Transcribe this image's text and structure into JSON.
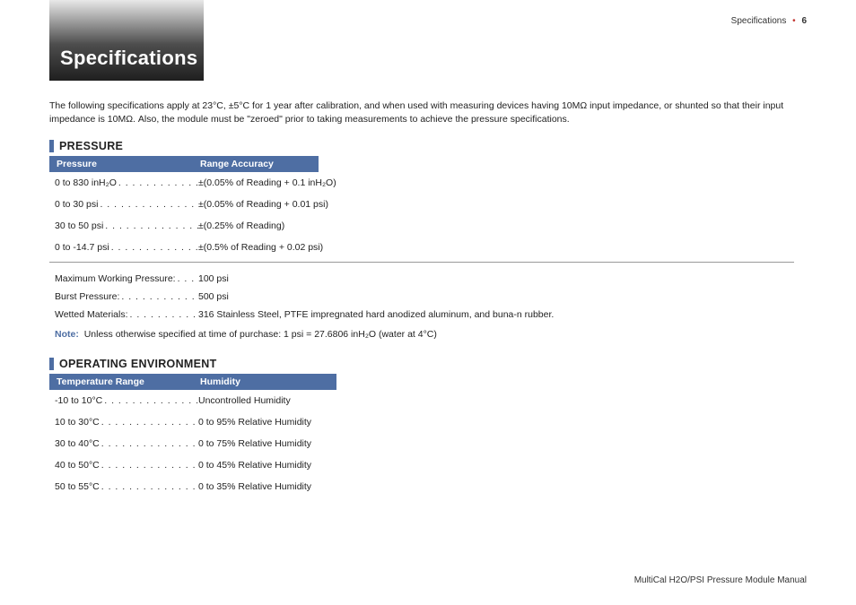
{
  "header": {
    "section": "Specifications",
    "page": "6"
  },
  "title": "Specifications",
  "intro": "The following specifications apply at 23°C, ±5°C for 1 year after calibration, and when used with measuring devices having 10MΩ input impedance, or shunted so that their input impedance is 10MΩ. Also, the module must be \"zeroed\" prior to taking measurements to achieve the pressure specifications.",
  "pressure": {
    "heading": "PRESSURE",
    "col1": "Pressure",
    "col2": "Range Accuracy",
    "rows": [
      {
        "range": "0 to 830 inH₂O",
        "accuracy": "±(0.05% of Reading + 0.1 inH₂O)"
      },
      {
        "range": "0 to 30 psi",
        "accuracy": "±(0.05% of Reading + 0.01 psi)"
      },
      {
        "range": "30 to 50 psi",
        "accuracy": "±(0.25% of Reading)"
      },
      {
        "range": "0 to -14.7 psi",
        "accuracy": "±(0.5% of Reading + 0.02 psi)"
      }
    ],
    "extras": [
      {
        "k": "Maximum Working Pressure:",
        "v": "100 psi"
      },
      {
        "k": "Burst Pressure:",
        "v": "500 psi"
      },
      {
        "k": "Wetted Materials:",
        "v": "316 Stainless Steel, PTFE impregnated hard anodized aluminum, and buna-n rubber."
      }
    ],
    "note_label": "Note:",
    "note_text": "Unless otherwise specified at time of purchase: 1 psi = 27.6806 inH₂O (water at 4°C)"
  },
  "env": {
    "heading": "OPERATING ENVIRONMENT",
    "col1": "Temperature Range",
    "col2": "Humidity",
    "rows": [
      {
        "t": "-10 to 10°C",
        "h": "Uncontrolled Humidity"
      },
      {
        "t": "10 to 30°C",
        "h": "0 to 95% Relative Humidity"
      },
      {
        "t": "30 to 40°C",
        "h": "0 to 75% Relative Humidity"
      },
      {
        "t": "40 to 50°C",
        "h": "0 to 45% Relative Humidity"
      },
      {
        "t": "50 to 55°C",
        "h": "0 to 35% Relative Humidity"
      }
    ]
  },
  "footer": "MultiCal H2O/PSI Pressure Module Manual"
}
